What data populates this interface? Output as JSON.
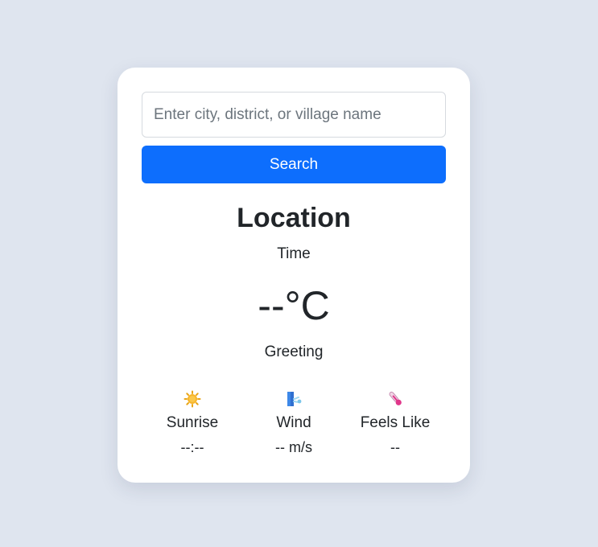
{
  "search": {
    "placeholder": "Enter city, district, or village name",
    "value": "",
    "button_label": "Search"
  },
  "weather": {
    "location": "Location",
    "time": "Time",
    "temperature": "--°C",
    "greeting": "Greeting"
  },
  "stats": [
    {
      "icon": "sunrise-icon",
      "label": "Sunrise",
      "value": "--:--"
    },
    {
      "icon": "wind-icon",
      "label": "Wind",
      "value": "-- m/s"
    },
    {
      "icon": "thermometer-icon",
      "label": "Feels Like",
      "value": "--"
    }
  ],
  "colors": {
    "background": "#dfe5ef",
    "card": "#ffffff",
    "accent": "#0d6efd",
    "text": "#212529"
  }
}
